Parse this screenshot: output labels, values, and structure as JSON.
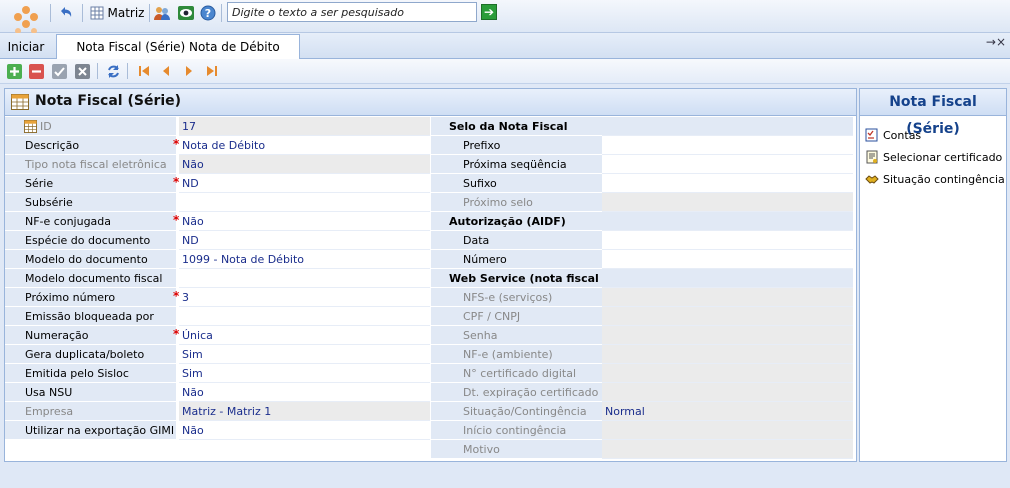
{
  "toolbar": {
    "matriz_label": "Matriz",
    "search_placeholder": "Digite o texto a ser pesquisado",
    "go_label": "➔"
  },
  "tabs": {
    "home": "Iniciar",
    "active": "Nota Fiscal (Série) Nota de Débito",
    "pin": "→×"
  },
  "main": {
    "title": "Nota Fiscal (Série)",
    "left_fields": [
      {
        "label": "ID",
        "value": "17",
        "disabled": true,
        "required": false
      },
      {
        "label": "Descrição",
        "value": "Nota de Débito",
        "disabled": false,
        "required": true
      },
      {
        "label": "Tipo nota fiscal eletrônica",
        "value": "Não",
        "disabled": true,
        "required": false
      },
      {
        "label": "Série",
        "value": "ND",
        "disabled": false,
        "required": true
      },
      {
        "label": "Subsérie",
        "value": "",
        "disabled": false,
        "required": false
      },
      {
        "label": "NF-e conjugada",
        "value": "Não",
        "disabled": false,
        "required": true
      },
      {
        "label": "Espécie do documento",
        "value": "ND",
        "disabled": false,
        "required": false
      },
      {
        "label": "Modelo do documento",
        "value": "1099 - Nota de Débito",
        "disabled": false,
        "required": false
      },
      {
        "label": "Modelo documento fiscal",
        "value": "",
        "disabled": false,
        "required": false
      },
      {
        "label": "Próximo número",
        "value": "3",
        "disabled": false,
        "required": true
      },
      {
        "label": "Emissão bloqueada por",
        "value": "",
        "disabled": false,
        "required": false
      },
      {
        "label": "Numeração",
        "value": "Única",
        "disabled": false,
        "required": true
      },
      {
        "label": "Gera duplicata/boleto",
        "value": "Sim",
        "disabled": false,
        "required": false
      },
      {
        "label": "Emitida pelo Sisloc",
        "value": "Sim",
        "disabled": false,
        "required": false
      },
      {
        "label": "Usa NSU",
        "value": "Não",
        "disabled": false,
        "required": false
      },
      {
        "label": "Empresa",
        "value": "Matriz - Matriz 1",
        "disabled": true,
        "required": false
      },
      {
        "label": "Utilizar na exportação GIMI",
        "value": "Não",
        "disabled": false,
        "required": false
      }
    ],
    "right_fields": [
      {
        "section": "Selo da Nota Fiscal"
      },
      {
        "label": "Prefixo",
        "value": "",
        "disabled": false
      },
      {
        "label": "Próxima seqüência",
        "value": "",
        "disabled": false
      },
      {
        "label": "Sufixo",
        "value": "",
        "disabled": false
      },
      {
        "label": "Próximo selo",
        "value": "",
        "disabled": true
      },
      {
        "section": "Autorização (AIDF)"
      },
      {
        "label": "Data",
        "value": "",
        "disabled": false
      },
      {
        "label": "Número",
        "value": "",
        "disabled": false
      },
      {
        "section": "Web Service (nota fiscal el"
      },
      {
        "label": "NFS-e (serviços)",
        "value": "",
        "disabled": true
      },
      {
        "label": "CPF / CNPJ",
        "value": "",
        "disabled": true
      },
      {
        "label": "Senha",
        "value": "",
        "disabled": true
      },
      {
        "label": "NF-e (ambiente)",
        "value": "",
        "disabled": true
      },
      {
        "label": "N° certificado digital",
        "value": "",
        "disabled": true
      },
      {
        "label": "Dt. expiração certificado",
        "value": "",
        "disabled": true
      },
      {
        "label": "Situação/Contingência",
        "value": "Normal",
        "disabled": true
      },
      {
        "label": "Início contingência",
        "value": "",
        "disabled": true
      },
      {
        "label": "Motivo",
        "value": "",
        "disabled": true
      }
    ]
  },
  "side": {
    "title": "Nota Fiscal (Série)",
    "items": [
      {
        "label": "Contas",
        "icon": "checklist-icon"
      },
      {
        "label": "Selecionar certificado",
        "icon": "certificate-icon"
      },
      {
        "label": "Situação contingência",
        "icon": "handshake-icon"
      }
    ]
  },
  "colors": {
    "value_text": "#1a2d8c",
    "label_bg": "#e1e9f5",
    "required": "#d00000"
  }
}
